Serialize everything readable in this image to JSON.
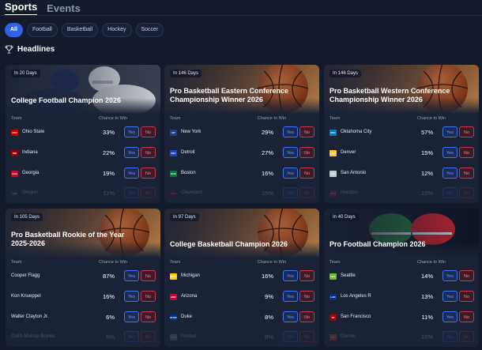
{
  "tabs": [
    {
      "label": "Sports",
      "active": true
    },
    {
      "label": "Events",
      "active": false
    }
  ],
  "filters": [
    {
      "label": "All",
      "active": true
    },
    {
      "label": "Football",
      "active": false
    },
    {
      "label": "Basketball",
      "active": false
    },
    {
      "label": "Hockey",
      "active": false
    },
    {
      "label": "Soccer",
      "active": false
    }
  ],
  "section_title": "Headlines",
  "columns": {
    "team": "Team",
    "chance": "Chance to Win"
  },
  "buttons": {
    "yes": "Yes",
    "no": "No"
  },
  "colors": {
    "accent": "#2f62e6",
    "yes": "#3f74f1",
    "no": "#c4384f",
    "background": "#131a2b",
    "card": "#1a2236"
  },
  "cards": [
    {
      "days": "In 20 Days",
      "title": "College Football Champion 2026",
      "art": "football-helmets",
      "rows": [
        {
          "team": "Ohio State",
          "abbr": "OSU",
          "color": "#bb0000",
          "chance": "33%"
        },
        {
          "team": "Indiana",
          "abbr": "IND",
          "color": "#990000",
          "chance": "22%"
        },
        {
          "team": "Georgia",
          "abbr": "UGA",
          "color": "#ba0c2f",
          "chance": "19%"
        },
        {
          "team": "Oregon",
          "abbr": "ORE",
          "color": "#154733",
          "chance": "11%"
        }
      ]
    },
    {
      "days": "In 146 Days",
      "title": "Pro Basketball Eastern Conference Championship Winner 2026",
      "art": "basketball",
      "rows": [
        {
          "team": "New York",
          "abbr": "NY",
          "color": "#1d428a",
          "chance": "29%"
        },
        {
          "team": "Detroit",
          "abbr": "DET",
          "color": "#1d42ba",
          "chance": "27%"
        },
        {
          "team": "Boston",
          "abbr": "BOS",
          "color": "#007a33",
          "chance": "16%"
        },
        {
          "team": "Cleveland",
          "abbr": "CLE",
          "color": "#860038",
          "chance": "15%"
        }
      ]
    },
    {
      "days": "In 146 Days",
      "title": "Pro Basketball Western Conference Championship Winner 2026",
      "art": "basketball",
      "rows": [
        {
          "team": "Oklahoma City",
          "abbr": "OKC",
          "color": "#007ac1",
          "chance": "57%"
        },
        {
          "team": "Denver",
          "abbr": "DEN",
          "color": "#fec524",
          "chance": "15%"
        },
        {
          "team": "San Antonio",
          "abbr": "SA",
          "color": "#c4ced4",
          "chance": "12%"
        },
        {
          "team": "Houston",
          "abbr": "HOU",
          "color": "#ce1141",
          "chance": "10%"
        }
      ]
    },
    {
      "days": "In 105 Days",
      "title": "Pro Basketball Rookie of the Year 2025-2026",
      "art": "basketball",
      "rows": [
        {
          "team": "Cooper Flagg",
          "abbr": "",
          "color": "",
          "chance": "87%"
        },
        {
          "team": "Kon Knueppel",
          "abbr": "",
          "color": "",
          "chance": "16%"
        },
        {
          "team": "Walter Clayton Jr.",
          "abbr": "",
          "color": "",
          "chance": "6%"
        },
        {
          "team": "Collin Murray-Boyles",
          "abbr": "",
          "color": "",
          "chance": "6%"
        }
      ]
    },
    {
      "days": "In 97 Days",
      "title": "College Basketball Champion 2026",
      "art": "basketball",
      "rows": [
        {
          "team": "Michigan",
          "abbr": "MICH",
          "color": "#ffcb05",
          "chance": "16%"
        },
        {
          "team": "Arizona",
          "abbr": "ARIZ",
          "color": "#cc0033",
          "chance": "9%"
        },
        {
          "team": "Duke",
          "abbr": "DUKE",
          "color": "#003087",
          "chance": "8%"
        },
        {
          "team": "Purdue",
          "abbr": "PUR",
          "color": "#9d9795",
          "chance": "8%"
        }
      ]
    },
    {
      "days": "In 40 Days",
      "title": "Pro Football Champion 2026",
      "art": "pro-helmets",
      "rows": [
        {
          "team": "Seattle",
          "abbr": "SEA",
          "color": "#69be28",
          "chance": "14%"
        },
        {
          "team": "Los Angeles R",
          "abbr": "LAR",
          "color": "#003594",
          "chance": "13%"
        },
        {
          "team": "San Francisco",
          "abbr": "SF",
          "color": "#aa0000",
          "chance": "11%"
        },
        {
          "team": "Denver",
          "abbr": "DEN",
          "color": "#fb4f14",
          "chance": "10%"
        }
      ]
    }
  ]
}
